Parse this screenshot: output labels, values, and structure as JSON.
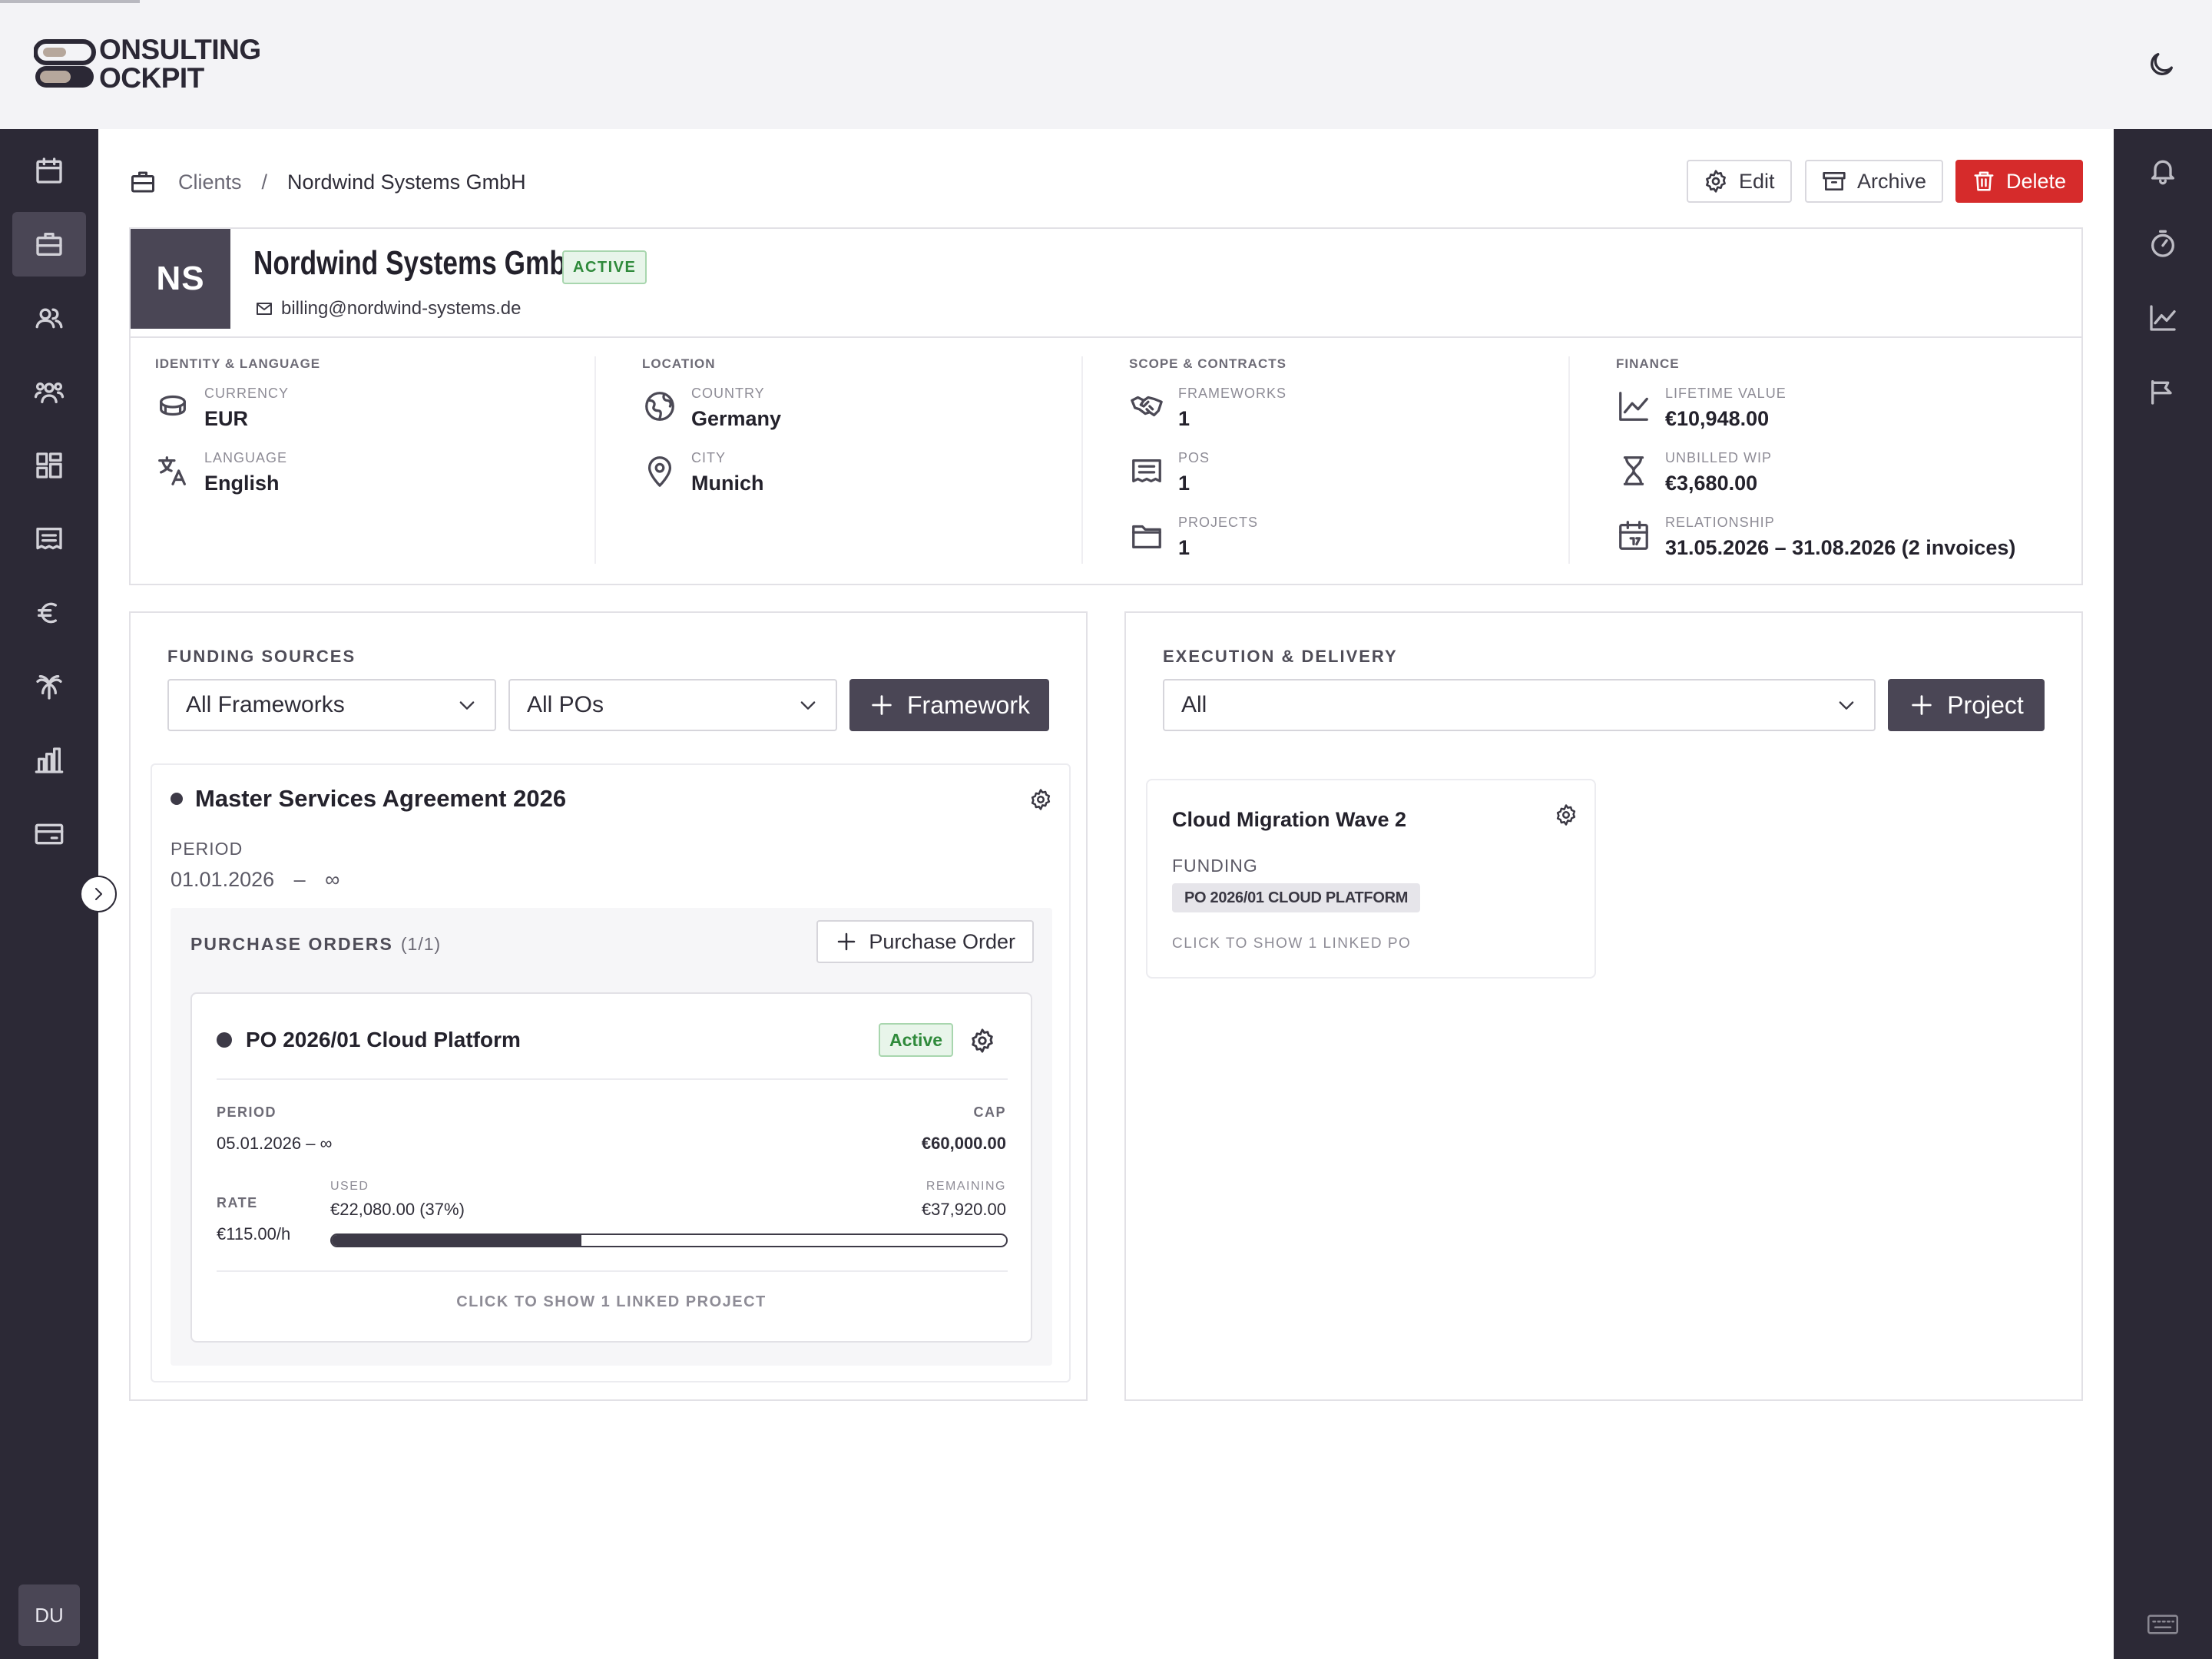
{
  "app": {
    "logo_text_line1": "ONSULTING",
    "logo_text_line2": "OCKPIT",
    "user_initials": "DU"
  },
  "breadcrumb": {
    "icon": "briefcase-icon",
    "root": "Clients",
    "separator": "/",
    "current": "Nordwind Systems GmbH"
  },
  "actions": {
    "edit": "Edit",
    "archive": "Archive",
    "delete": "Delete"
  },
  "client": {
    "initials": "NS",
    "name": "Nordwind Systems GmbH",
    "status": "ACTIVE",
    "email": "billing@nordwind-systems.de"
  },
  "sections": {
    "identity": {
      "title": "IDENTITY & LANGUAGE",
      "currency_label": "CURRENCY",
      "currency": "EUR",
      "language_label": "LANGUAGE",
      "language": "English"
    },
    "location": {
      "title": "LOCATION",
      "country_label": "COUNTRY",
      "country": "Germany",
      "city_label": "CITY",
      "city": "Munich"
    },
    "scope": {
      "title": "SCOPE & CONTRACTS",
      "frameworks_label": "FRAMEWORKS",
      "frameworks": "1",
      "pos_label": "POS",
      "pos": "1",
      "projects_label": "PROJECTS",
      "projects": "1"
    },
    "finance": {
      "title": "FINANCE",
      "lifetime_label": "LIFETIME VALUE",
      "lifetime": "€10,948.00",
      "wip_label": "UNBILLED WIP",
      "wip": "€3,680.00",
      "relationship_label": "RELATIONSHIP",
      "relationship": "31.05.2026 – 31.08.2026 (2 invoices)"
    }
  },
  "funding": {
    "title": "FUNDING SOURCES",
    "filter_frameworks": "All Frameworks",
    "filter_pos": "All POs",
    "add_framework": "Framework",
    "framework": {
      "name": "Master Services Agreement 2026",
      "period_label": "PERIOD",
      "period": "01.01.2026 – ∞",
      "po_header": "PURCHASE ORDERS",
      "po_count": "(1/1)",
      "add_po": "Purchase Order",
      "po": {
        "name": "PO 2026/01 Cloud Platform",
        "status": "Active",
        "period_label": "PERIOD",
        "period": "05.01.2026 – ∞",
        "cap_label": "CAP",
        "cap": "€60,000.00",
        "rate_label": "RATE",
        "rate": "€115.00/h",
        "used_label": "USED",
        "used": "€22,080.00 (37%)",
        "used_fraction": 0.37,
        "remaining_label": "REMAINING",
        "remaining": "€37,920.00",
        "linked": "CLICK TO SHOW 1 LINKED PROJECT"
      }
    }
  },
  "execution": {
    "title": "EXECUTION & DELIVERY",
    "filter": "All",
    "add_project": "Project",
    "project": {
      "name": "Cloud Migration Wave 2",
      "funding_label": "FUNDING",
      "funding": "PO 2026/01 CLOUD PLATFORM",
      "linked": "CLICK TO SHOW 1 LINKED PO"
    }
  },
  "colors": {
    "sidebar": "#2c2936",
    "accent": "#4a4655",
    "danger": "#d62b2b",
    "success": "#2f8a3b"
  }
}
